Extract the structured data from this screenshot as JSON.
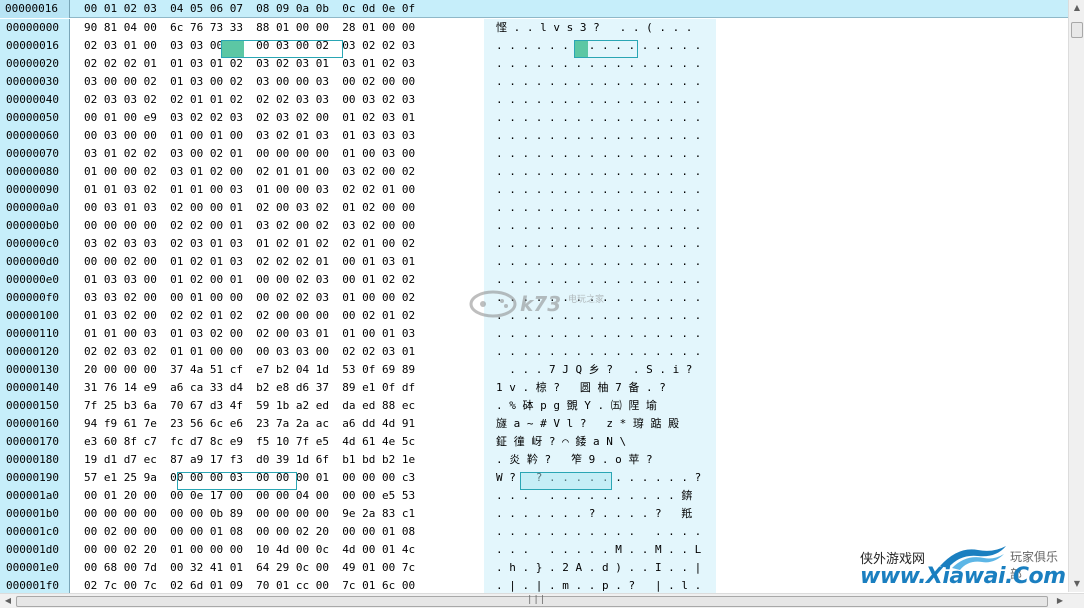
{
  "header": {
    "offset_label": "00000016",
    "columns": "00 01 02 03  04 05 06 07  08 09 0a 0b  0c 0d 0e 0f"
  },
  "rows": [
    {
      "offset": "00000000",
      "hex": "90 81 04 00  6c 76 73 33  88 01 00 00  28 01 00 00",
      "ascii": "悭 . . l v s 3 ?   . . ( . . ."
    },
    {
      "offset": "00000016",
      "hex": "02 03 01 00  03 03 00 00  00 03 00 02  03 02 02 03",
      "ascii": ". . . . . . . . . . . . . . . ."
    },
    {
      "offset": "00000020",
      "hex": "02 02 02 01  01 03 01 02  03 02 03 01  03 01 02 03",
      "ascii": ". . . . . . . . . . . . . . . ."
    },
    {
      "offset": "00000030",
      "hex": "03 00 00 02  01 03 00 02  03 00 00 03  00 02 00 00",
      "ascii": ". . . . . . . . . . . . . . . ."
    },
    {
      "offset": "00000040",
      "hex": "02 03 03 02  02 01 01 02  02 02 03 03  00 03 02 03",
      "ascii": ". . . . . . . . . . . . . . . ."
    },
    {
      "offset": "00000050",
      "hex": "00 01 00 e9  03 02 02 03  02 03 02 00  01 02 03 01",
      "ascii": ". . . . . . . . . . . . . . . ."
    },
    {
      "offset": "00000060",
      "hex": "00 03 00 00  01 00 01 00  03 02 01 03  01 03 03 03",
      "ascii": ". . . . . . . . . . . . . . . ."
    },
    {
      "offset": "00000070",
      "hex": "03 01 02 02  03 00 02 01  00 00 00 00  01 00 03 00",
      "ascii": ". . . . . . . . . . . . . . . ."
    },
    {
      "offset": "00000080",
      "hex": "01 00 00 02  03 01 02 00  02 01 01 00  03 02 00 02",
      "ascii": ". . . . . . . . . . . . . . . ."
    },
    {
      "offset": "00000090",
      "hex": "01 01 03 02  01 01 00 03  01 00 00 03  02 02 01 00",
      "ascii": ". . . . . . . . . . . . . . . ."
    },
    {
      "offset": "000000a0",
      "hex": "00 03 01 03  02 00 00 01  02 00 03 02  01 02 00 00",
      "ascii": ". . . . . . . . . . . . . . . ."
    },
    {
      "offset": "000000b0",
      "hex": "00 00 00 00  02 02 00 01  03 02 00 02  03 02 00 00",
      "ascii": ". . . . . . . . . . . . . . . ."
    },
    {
      "offset": "000000c0",
      "hex": "03 02 03 03  02 03 01 03  01 02 01 02  02 01 00 02",
      "ascii": ". . . . . . . . . . . . . . . ."
    },
    {
      "offset": "000000d0",
      "hex": "00 00 02 00  01 02 01 03  02 02 02 01  00 01 03 01",
      "ascii": ". . . . . . . . . . . . . . . ."
    },
    {
      "offset": "000000e0",
      "hex": "01 03 03 00  01 02 00 01  00 00 02 03  00 01 02 02",
      "ascii": ". . . . . . . . . . . . . . . ."
    },
    {
      "offset": "000000f0",
      "hex": "03 03 02 00  00 01 00 00  00 02 02 03  01 00 00 02",
      "ascii": ". . . . . . . . . . . . . . . ."
    },
    {
      "offset": "00000100",
      "hex": "01 03 02 00  02 02 01 02  02 00 00 00  00 02 01 02",
      "ascii": ". . . . . . . . . . . . . . . ."
    },
    {
      "offset": "00000110",
      "hex": "01 01 00 03  01 03 02 00  02 00 03 01  01 00 01 03",
      "ascii": ". . . . . . . . . . . . . . . ."
    },
    {
      "offset": "00000120",
      "hex": "02 02 03 02  01 01 00 00  00 03 03 00  02 02 03 01",
      "ascii": ". . . . . . . . . . . . . . . ."
    },
    {
      "offset": "00000130",
      "hex": "20 00 00 00  37 4a 51 cf  e7 b2 04 1d  53 0f 69 89",
      "ascii": "  . . . 7 J Q 乡 ?   . S . i ?"
    },
    {
      "offset": "00000140",
      "hex": "31 76 14 e9  a6 ca 33 d4  b2 e8 d6 37  89 e1 0f df",
      "ascii": "1 v . 椋 ?   圆 柚 7 备 . ?"
    },
    {
      "offset": "00000150",
      "hex": "7f 25 b3 6a  70 67 d3 4f  59 1b a2 ed  da ed 88 ec",
      "ascii": ". % 砵 p g 覴 Y . ㈤ 陧 堬"
    },
    {
      "offset": "00000160",
      "hex": "94 f9 61 7e  23 56 6c e6  23 7a 2a ac  a6 dd 4d 91",
      "ascii": "旞 a ~ # V l ?   z * 瑏 踮 殿"
    },
    {
      "offset": "00000170",
      "hex": "e3 60 8f c7  fc d7 8c e9  f5 10 7f e5  4d 61 4e 5c",
      "ascii": "鉦 徸 岈 ? ⌒ 錗 a N \\"
    },
    {
      "offset": "00000180",
      "hex": "19 d1 d7 ec  87 a9 17 f3  d0 39 1d 6f  b1 bd b2 1e",
      "ascii": ". 炎 靲 ?   笮 9 . o 苹 ?"
    },
    {
      "offset": "00000190",
      "hex": "57 e1 25 9a  00 00 00 03  00 00 00 01  00 00 00 c3",
      "ascii": "W ?   ? . . . . . . . . . . . ?"
    },
    {
      "offset": "000001a0",
      "hex": "00 01 20 00  00 0e 17 00  00 00 04 00  00 00 e5 53",
      "ascii": ". . .   . . . . . . . . . . 錛"
    },
    {
      "offset": "000001b0",
      "hex": "00 00 00 00  00 00 0b 89  00 00 00 00  9e 2a 83 c1",
      "ascii": ". . . . . . . ? . . . . ?   羝"
    },
    {
      "offset": "000001c0",
      "hex": "00 02 00 00  00 00 01 08  00 00 02 20  00 00 01 08",
      "ascii": ". . . . . . . . . . .   . . . ."
    },
    {
      "offset": "000001d0",
      "hex": "00 00 02 20  01 00 00 00  10 4d 00 0c  4d 00 01 4c",
      "ascii": ". . .   . . . . . M . . M . . L"
    },
    {
      "offset": "000001e0",
      "hex": "00 68 00 7d  00 32 41 01  64 29 0c 00  49 01 00 7c",
      "ascii": ". h . } . 2 A . d ) . . I . . |"
    },
    {
      "offset": "000001f0",
      "hex": "02 7c 00 7c  02 6d 01 09  70 01 cc 00  7c 01 6c 00",
      "ascii": ". | . | . m . . p . ?   | . l ."
    }
  ],
  "scrollbar": {
    "grip": "|||"
  },
  "watermarks": {
    "k73_text": "k73",
    "k73_sub": "电玩之家",
    "xiawai_cn": "侠外游戏网",
    "xiawai_club": "玩家俱乐部",
    "xiawai_url": "www.Xiawai.Com"
  },
  "colors": {
    "header_bg": "#c6eefa",
    "ascii_bg": "#e3f6fc",
    "selection_border": "#2aa6b4",
    "selection_fill": "#5cc7a4",
    "watermark_blue": "#1a7fc0"
  }
}
